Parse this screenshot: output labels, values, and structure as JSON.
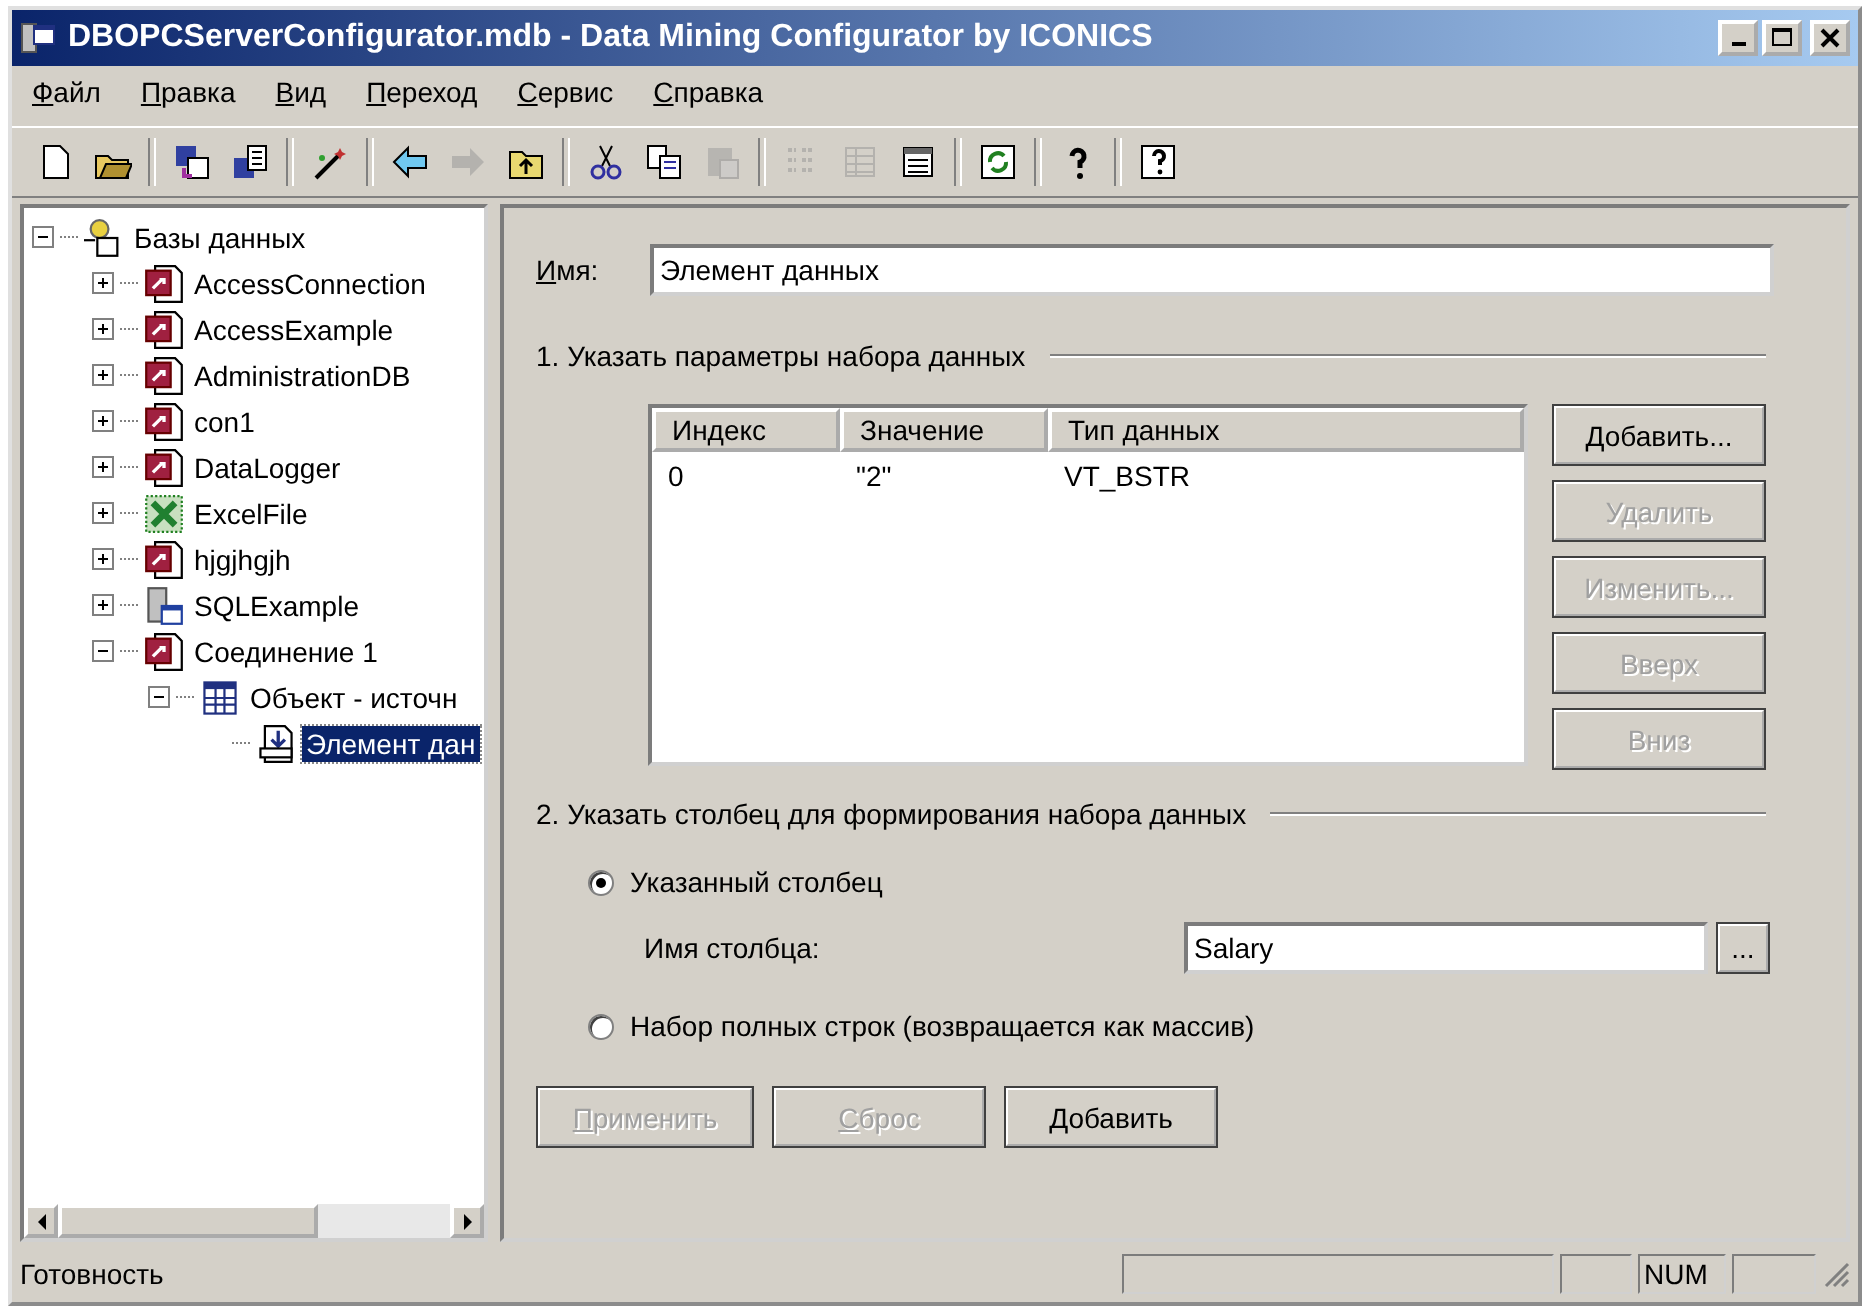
{
  "window": {
    "title": "DBOPCServerConfigurator.mdb - Data Mining Configurator by ICONICS"
  },
  "menu": [
    "Файл",
    "Правка",
    "Вид",
    "Переход",
    "Сервис",
    "Справка"
  ],
  "toolbar": [
    {
      "kind": "new",
      "disabled": false
    },
    {
      "kind": "open",
      "disabled": false
    },
    {
      "kind": "sep"
    },
    {
      "kind": "save-as",
      "disabled": false
    },
    {
      "kind": "save-to",
      "disabled": false
    },
    {
      "kind": "sep"
    },
    {
      "kind": "wand",
      "disabled": false
    },
    {
      "kind": "sep"
    },
    {
      "kind": "back",
      "disabled": false
    },
    {
      "kind": "forward",
      "disabled": true
    },
    {
      "kind": "up",
      "disabled": false
    },
    {
      "kind": "sep"
    },
    {
      "kind": "cut",
      "disabled": false
    },
    {
      "kind": "copy",
      "disabled": false
    },
    {
      "kind": "paste",
      "disabled": true
    },
    {
      "kind": "sep"
    },
    {
      "kind": "list",
      "disabled": true
    },
    {
      "kind": "details",
      "disabled": true
    },
    {
      "kind": "props",
      "disabled": false
    },
    {
      "kind": "sep"
    },
    {
      "kind": "refresh",
      "disabled": false
    },
    {
      "kind": "sep"
    },
    {
      "kind": "help",
      "disabled": false
    },
    {
      "kind": "sep"
    },
    {
      "kind": "context-help",
      "disabled": false
    }
  ],
  "tree": [
    {
      "label": "Базы данных",
      "kind": "root",
      "expanded": true,
      "selected": false,
      "children": [
        {
          "label": "AccessConnection",
          "kind": "access",
          "expanded": false,
          "selected": false
        },
        {
          "label": "AccessExample",
          "kind": "access",
          "expanded": false,
          "selected": false
        },
        {
          "label": "AdministrationDB",
          "kind": "access",
          "expanded": false,
          "selected": false
        },
        {
          "label": "con1",
          "kind": "access",
          "expanded": false,
          "selected": false
        },
        {
          "label": "DataLogger",
          "kind": "access",
          "expanded": false,
          "selected": false
        },
        {
          "label": "ExcelFile",
          "kind": "excel",
          "expanded": false,
          "selected": false
        },
        {
          "label": "hjgjhgjh",
          "kind": "access",
          "expanded": false,
          "selected": false
        },
        {
          "label": "SQLExample",
          "kind": "sql",
          "expanded": false,
          "selected": false
        },
        {
          "label": "Соединение 1",
          "kind": "access",
          "expanded": true,
          "selected": false,
          "children": [
            {
              "label": "Объект - источн",
              "kind": "table",
              "expanded": true,
              "selected": false,
              "children": [
                {
                  "label": "Элемент дан",
                  "kind": "item",
                  "selected": true
                }
              ]
            }
          ]
        }
      ]
    }
  ],
  "form": {
    "name_label": "Имя:",
    "name_value": "Элемент данных",
    "section1": "1. Указать параметры набора данных",
    "table": {
      "columns": [
        "Индекс",
        "Значение",
        "Тип данных"
      ],
      "rows": [
        [
          "0",
          "\"2\"",
          "VT_BSTR"
        ]
      ]
    },
    "side_buttons": [
      {
        "label": "Добавить...",
        "disabled": false
      },
      {
        "label": "Удалить",
        "disabled": true
      },
      {
        "label": "Изменить...",
        "disabled": true
      },
      {
        "label": "Вверх",
        "disabled": true
      },
      {
        "label": "Вниз",
        "disabled": true
      }
    ],
    "section2": "2. Указать столбец для формирования набора данных",
    "radio_specified": {
      "label": "Указанный столбец",
      "selected": true
    },
    "column_label": "Имя столбца:",
    "column_value": "Salary",
    "browse_button": "...",
    "radio_full": {
      "label": "Набор полных строк (возвращается как массив)",
      "selected": false
    },
    "bottom_buttons": [
      {
        "label": "Применить",
        "disabled": true
      },
      {
        "label": "Сброс",
        "disabled": true
      },
      {
        "label": "Добавить",
        "disabled": false
      }
    ]
  },
  "status_bar": {
    "text": "Готовность",
    "num_indicator": "NUM"
  }
}
